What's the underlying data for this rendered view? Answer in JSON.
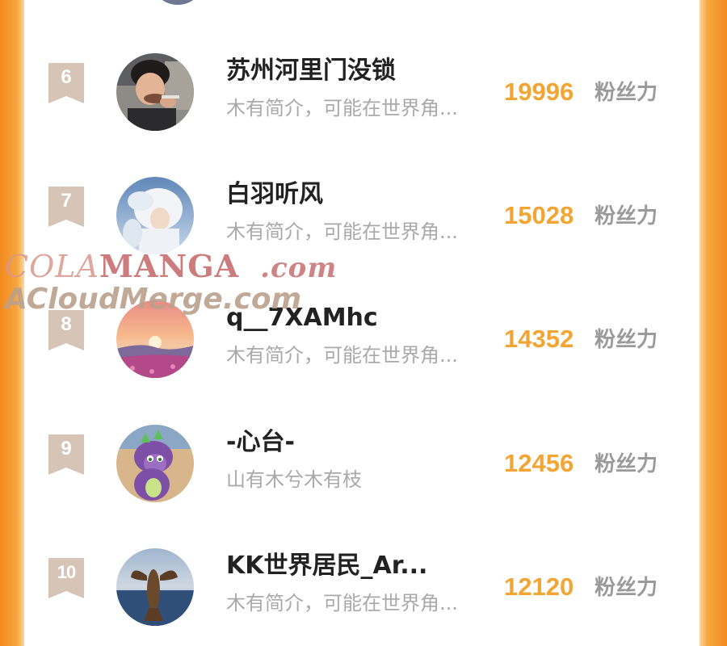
{
  "unit_label": "粉丝力",
  "watermark": {
    "part_cola": "COLA",
    "part_manga": "MANGA",
    "part_com": ".com",
    "line2": "ACloudMerge.com"
  },
  "ranking": [
    {
      "rank": "6",
      "name": "苏州河里门没锁",
      "bio": "木有简介，可能在世界角...",
      "score": "19996",
      "avatar_icon": "woman-eating-avatar"
    },
    {
      "rank": "7",
      "name": "白羽听风",
      "bio": "木有简介，可能在世界角...",
      "score": "15028",
      "avatar_icon": "white-haired-figure-avatar"
    },
    {
      "rank": "8",
      "name": "q__7XAMhc",
      "bio": "木有简介，可能在世界角...",
      "score": "14352",
      "avatar_icon": "sunset-flower-field-avatar"
    },
    {
      "rank": "9",
      "name": "-心台-",
      "bio": "山有木兮木有枝",
      "score": "12456",
      "avatar_icon": "purple-dragon-cartoon-avatar"
    },
    {
      "rank": "10",
      "name": "KK世界居民_Ar...",
      "bio": "木有简介，可能在世界角...",
      "score": "12120",
      "avatar_icon": "lobster-sea-avatar"
    }
  ],
  "colors": {
    "frame_orange": "#f59a2c",
    "score_orange": "#f3a533",
    "badge_beige": "#d6c5b6",
    "name_text": "#222222",
    "bio_text": "#a9a9a9"
  }
}
